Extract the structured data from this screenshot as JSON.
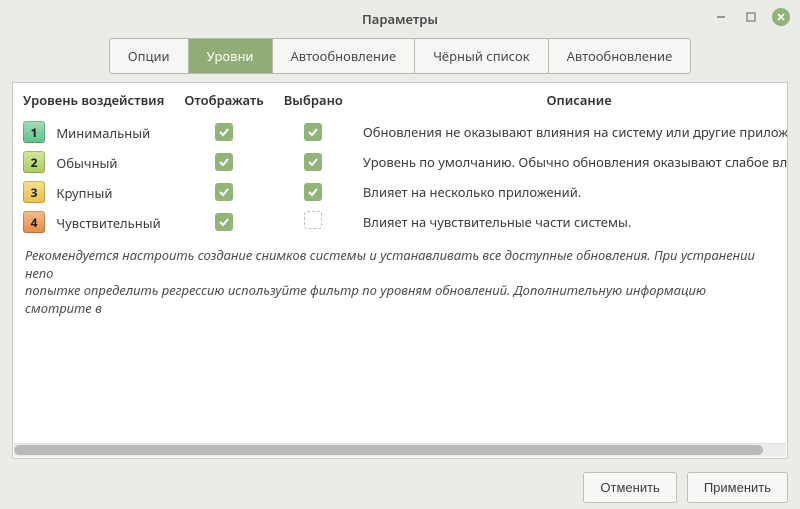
{
  "title": "Параметры",
  "tabs": [
    {
      "label": "Опции"
    },
    {
      "label": "Уровни",
      "active": true
    },
    {
      "label": "Автообновление"
    },
    {
      "label": "Чёрный список"
    },
    {
      "label": "Автообновление"
    }
  ],
  "columns": {
    "level": "Уровень воздействия",
    "display": "Отображать",
    "selected": "Выбрано",
    "description": "Описание"
  },
  "rows": [
    {
      "num": "1",
      "name": "Минимальный",
      "display": true,
      "selected": true,
      "desc": "Обновления не оказывают влияния на систему или другие приложе"
    },
    {
      "num": "2",
      "name": "Обычный",
      "display": true,
      "selected": true,
      "desc": "Уровень по умолчанию. Обычно обновления оказывают слабое вли"
    },
    {
      "num": "3",
      "name": "Крупный",
      "display": true,
      "selected": true,
      "desc": "Влияет на несколько приложений."
    },
    {
      "num": "4",
      "name": "Чувствительный",
      "display": true,
      "selected": false,
      "desc": "Влияет на чувствительные части системы."
    }
  ],
  "note_line1": "Рекомендуется настроить создание снимков системы и устанавливать все доступные обновления. При устранении непо",
  "note_line2": "попытке определить регрессию используйте фильтр по уровням обновлений. Дополнительную информацию смотрите в",
  "buttons": {
    "cancel": "Отменить",
    "apply": "Применить"
  }
}
